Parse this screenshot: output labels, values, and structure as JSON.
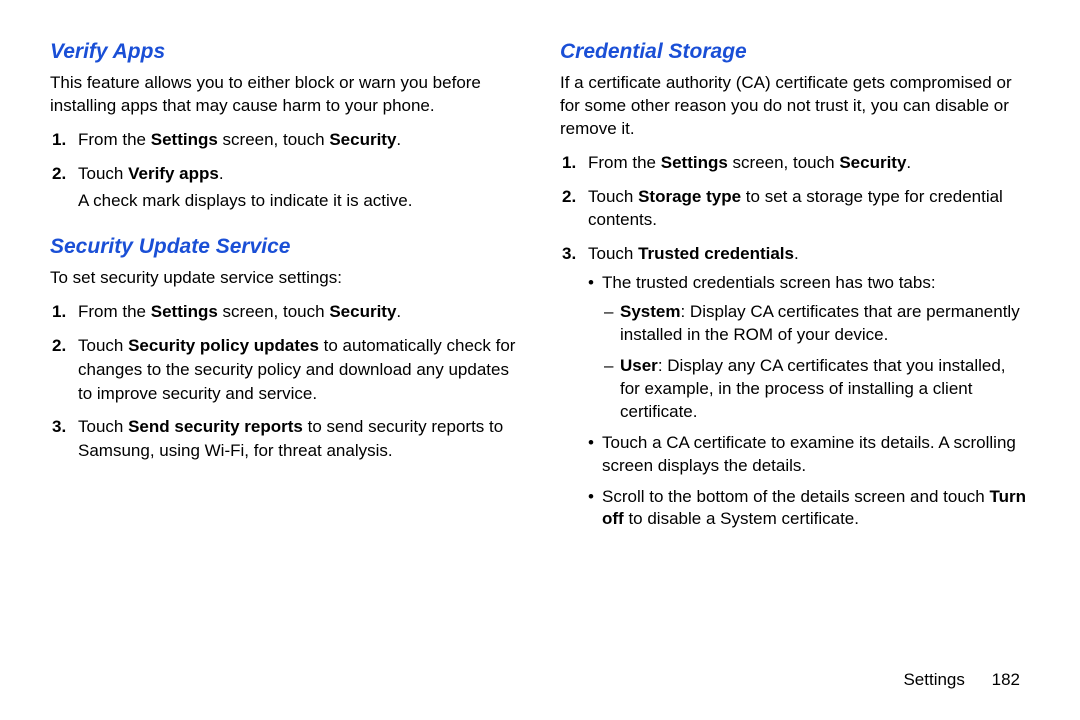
{
  "left": {
    "sec1": {
      "heading": "Verify Apps",
      "intro": "This feature allows you to either block or warn you before installing apps that may cause harm to your phone.",
      "step1_a": "From the ",
      "step1_b": "Settings",
      "step1_c": " screen, touch ",
      "step1_d": "Security",
      "step1_e": ".",
      "step2_a": "Touch ",
      "step2_b": "Verify apps",
      "step2_c": ".",
      "step2_sub": "A check mark displays to indicate it is active."
    },
    "sec2": {
      "heading": "Security Update Service",
      "intro": "To set security update service settings:",
      "step1_a": "From the ",
      "step1_b": "Settings",
      "step1_c": " screen, touch ",
      "step1_d": "Security",
      "step1_e": ".",
      "step2_a": "Touch ",
      "step2_b": "Security policy updates",
      "step2_c": " to automatically check for changes to the security policy and download any updates to improve security and service.",
      "step3_a": "Touch ",
      "step3_b": "Send security reports",
      "step3_c": " to send security reports to Samsung, using Wi-Fi, for threat analysis."
    }
  },
  "right": {
    "sec1": {
      "heading": "Credential Storage",
      "intro": "If a certificate authority (CA) certificate gets compromised or for some other reason you do not trust it, you can disable or remove it.",
      "step1_a": "From the ",
      "step1_b": "Settings",
      "step1_c": " screen, touch ",
      "step1_d": "Security",
      "step1_e": ".",
      "step2_a": "Touch ",
      "step2_b": "Storage type",
      "step2_c": " to set a storage type for credential contents.",
      "step3_a": "Touch ",
      "step3_b": "Trusted credentials",
      "step3_c": ".",
      "bullet1": "The trusted credentials screen has two tabs:",
      "dash1_a": "System",
      "dash1_b": ": Display CA certificates that are permanently installed in the ROM of your device.",
      "dash2_a": "User",
      "dash2_b": ": Display any CA certificates that you installed, for example, in the process of installing a client certificate.",
      "bullet2": "Touch a CA certificate to examine its details. A scrolling screen displays the details.",
      "bullet3_a": "Scroll to the bottom of the details screen and touch ",
      "bullet3_b": "Turn off",
      "bullet3_c": " to disable a System certificate."
    }
  },
  "footer": {
    "section": "Settings",
    "page": "182"
  }
}
